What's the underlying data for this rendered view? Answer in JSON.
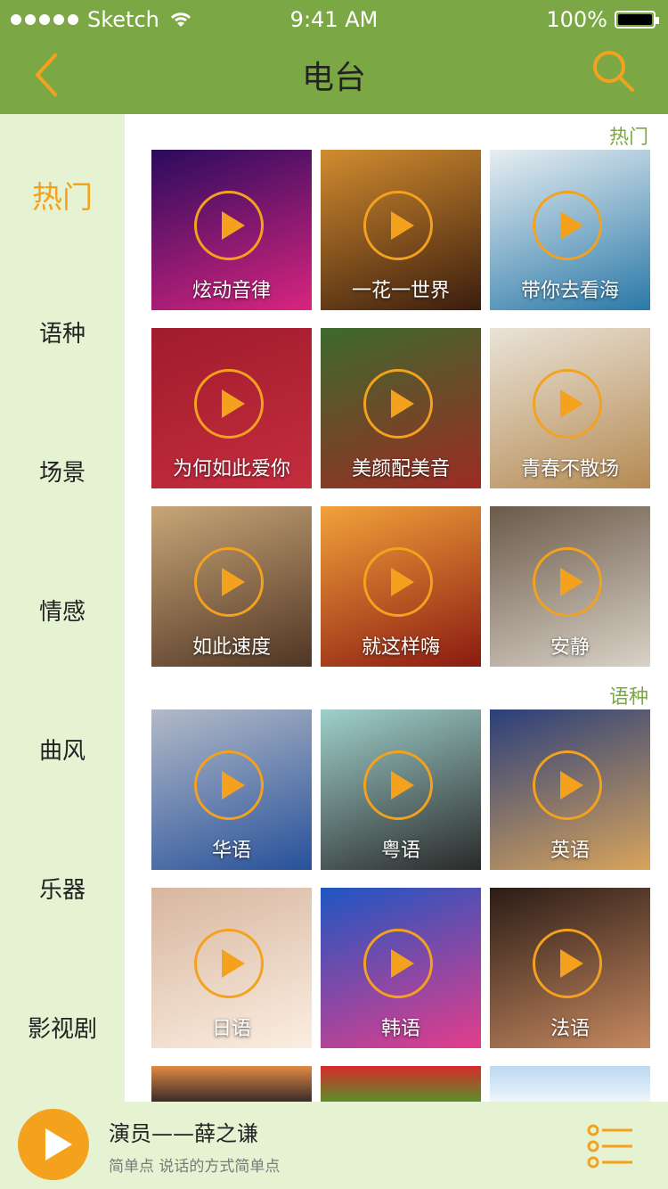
{
  "status_bar": {
    "carrier": "Sketch",
    "time": "9:41 AM",
    "battery": "100%"
  },
  "nav": {
    "title": "电台",
    "back_icon": "chevron-left-icon",
    "search_icon": "search-icon"
  },
  "sidebar": {
    "items": [
      {
        "label": "热门",
        "active": true
      },
      {
        "label": "语种"
      },
      {
        "label": "场景"
      },
      {
        "label": "情感"
      },
      {
        "label": "曲风"
      },
      {
        "label": "乐器"
      },
      {
        "label": "影视剧"
      }
    ]
  },
  "sections": [
    {
      "title": "热门",
      "tiles": [
        {
          "label": "炫动音律",
          "colors": [
            "#2a0b5e",
            "#d9257e"
          ]
        },
        {
          "label": "一花一世界",
          "colors": [
            "#d18c2f",
            "#3b1d0e"
          ]
        },
        {
          "label": "带你去看海",
          "colors": [
            "#e8eef2",
            "#2a79a8"
          ]
        },
        {
          "label": "为何如此爱你",
          "colors": [
            "#a01c2d",
            "#c52d3e"
          ]
        },
        {
          "label": "美颜配美音",
          "colors": [
            "#3c6a2e",
            "#9c2b24"
          ]
        },
        {
          "label": "青春不散场",
          "colors": [
            "#e9e3d7",
            "#b58a53"
          ]
        },
        {
          "label": "如此速度",
          "colors": [
            "#c8a678",
            "#4f3524"
          ]
        },
        {
          "label": "就这样嗨",
          "colors": [
            "#f2a23a",
            "#8a1a12"
          ]
        },
        {
          "label": "安静",
          "colors": [
            "#6b5a4a",
            "#d9d2c6"
          ]
        }
      ]
    },
    {
      "title": "语种",
      "tiles": [
        {
          "label": "华语",
          "colors": [
            "#b3bac7",
            "#27519a"
          ]
        },
        {
          "label": "粤语",
          "colors": [
            "#9fd0cb",
            "#2a2a2a"
          ]
        },
        {
          "label": "英语",
          "colors": [
            "#2a3f7a",
            "#d8a45c"
          ]
        },
        {
          "label": "日语",
          "colors": [
            "#d7b6a0",
            "#fbeee0"
          ]
        },
        {
          "label": "韩语",
          "colors": [
            "#1e56c2",
            "#e43d8b"
          ]
        },
        {
          "label": "法语",
          "colors": [
            "#2b1c16",
            "#c68960"
          ]
        }
      ]
    }
  ],
  "partial_row": [
    {
      "colors": [
        "#e08a42",
        "#3a2b2a"
      ]
    },
    {
      "colors": [
        "#d62a2a",
        "#5c8f2c"
      ]
    },
    {
      "colors": [
        "#bcd8f0",
        "#eef6fd"
      ]
    }
  ],
  "player": {
    "song": "演员——薛之谦",
    "subtitle": "简单点  说话的方式简单点",
    "play_icon": "play-icon",
    "list_icon": "playlist-icon"
  },
  "colors": {
    "accent": "#f4a21e",
    "brand_green": "#7ba845",
    "sidebar_bg": "#e5f3d2"
  }
}
